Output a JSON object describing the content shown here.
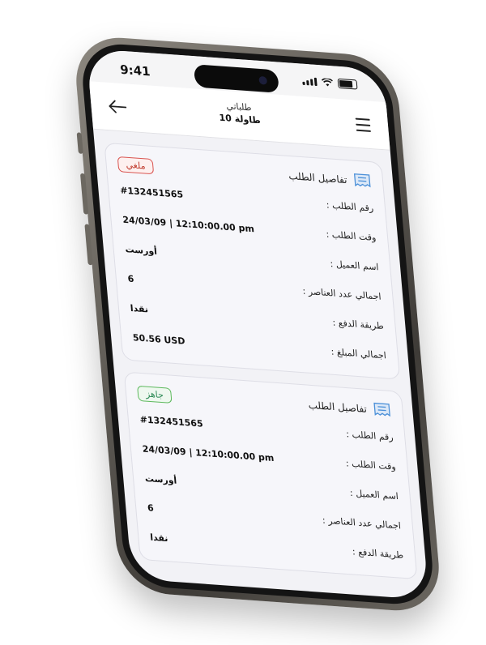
{
  "status_bar": {
    "time": "9:41"
  },
  "header": {
    "title": "طلباتي",
    "subtitle": "طاولة 10"
  },
  "orders": [
    {
      "card_title": "تفاصيل الطلب",
      "status": "ملغي",
      "status_color": "#d9534f",
      "fields": [
        {
          "label": "رقم الطلب :",
          "value": "#132451565"
        },
        {
          "label": "وقت الطلب :",
          "value": "24/03/09 | 12:10:00.00 pm"
        },
        {
          "label": "اسم العميل :",
          "value": "أورست"
        },
        {
          "label": "اجمالي عدد العناصر :",
          "value": "6"
        },
        {
          "label": "طريقة الدفع :",
          "value": "نقدا"
        },
        {
          "label": "اجمالي المبلغ :",
          "value": "50.56 USD"
        }
      ]
    },
    {
      "card_title": "تفاصيل الطلب",
      "status": "جاهز",
      "status_color": "#5cb85c",
      "fields": [
        {
          "label": "رقم الطلب :",
          "value": "#132451565"
        },
        {
          "label": "وقت الطلب :",
          "value": "24/03/09 | 12:10:00.00 pm"
        },
        {
          "label": "اسم العميل :",
          "value": "أورست"
        },
        {
          "label": "اجمالي عدد العناصر :",
          "value": "6"
        },
        {
          "label": "طريقة الدفع :",
          "value": "نقدا"
        }
      ]
    }
  ],
  "icons": {
    "back": "arrow-left-icon",
    "menu": "hamburger-menu-icon",
    "receipt": "receipt-icon"
  }
}
